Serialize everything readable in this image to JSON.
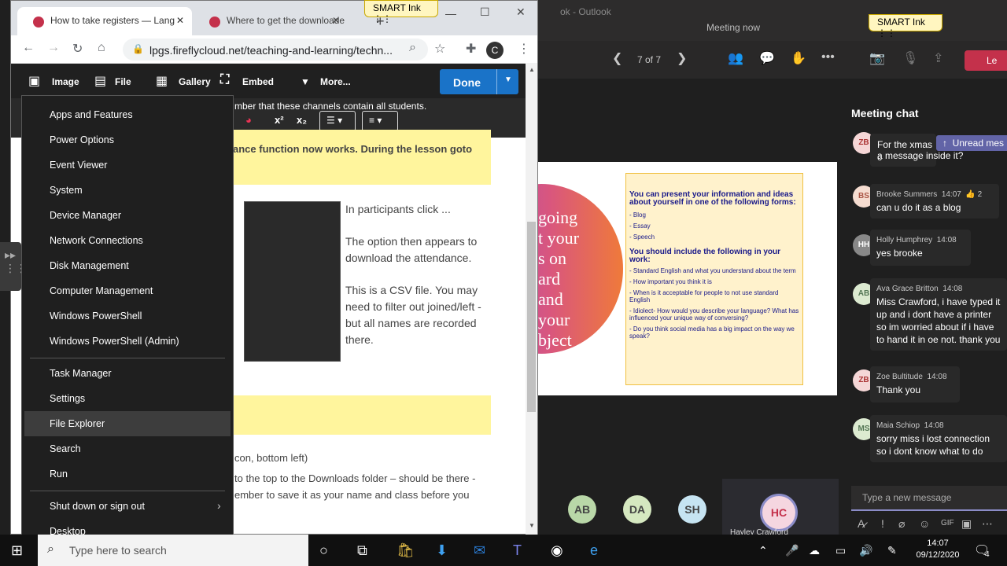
{
  "teams": {
    "window_title_left": "ok - Outlook",
    "window_title_right": "Meeting now",
    "page_counter": "7 of 7",
    "leave_label": "Le",
    "chat_title": "Meeting chat",
    "unread_label": "Unread mes",
    "compose_placeholder": "Type a new message",
    "slide": {
      "words": [
        "going",
        "t your",
        "s on",
        "ard",
        "and",
        "your",
        "bject"
      ],
      "heading": "You can present your information and ideas about yourself in one of the following forms:",
      "forms": [
        "- Blog",
        "- Essay",
        "- Speech"
      ],
      "heading2": "You should include the following in your work:",
      "points": [
        "- Standard English and what you understand about the term",
        "- How important you think it is",
        "- When is it acceptable for people to not use standard English",
        "- Idiolect- How would you describe your language? What has influenced your unique way of conversing?",
        "- Do you think social media has a big impact on the way we speak?"
      ]
    },
    "participants": [
      "AB",
      "DA",
      "SH"
    ],
    "presenter": {
      "initials": "HC",
      "name": "Hayley Crawford"
    },
    "messages": [
      {
        "initials": "ZB",
        "name": "",
        "time": "",
        "text": "For the xmas c... a message inside it?",
        "line1": "For the xmas c",
        "line2": "a message inside it?"
      },
      {
        "initials": "BS",
        "name": "Brooke Summers",
        "time": "14:07",
        "reaction": "2",
        "text": "can u do it as a blog"
      },
      {
        "initials": "HH",
        "name": "Holly Humphrey",
        "time": "14:08",
        "text": "yes brooke"
      },
      {
        "initials": "AB",
        "name": "Ava Grace Britton",
        "time": "14:08",
        "text": "Miss Crawford, i have typed it up and i dont have a printer so im worried about if i have to hand it in oe not. thank you"
      },
      {
        "initials": "ZB",
        "name": "Zoe Bultitude",
        "time": "14:08",
        "text": "Thank you"
      },
      {
        "initials": "MS",
        "name": "Maia Schiop",
        "time": "14:08",
        "text": "sorry miss i lost connection so i dont know what to do"
      }
    ]
  },
  "chrome": {
    "tabs": [
      {
        "label": "How to take registers — Lang"
      },
      {
        "label": "Where to get the downloade"
      }
    ],
    "url": "lpgs.fireflycloud.net/teaching-and-learning/techn...",
    "profile_initial": "C",
    "smart_ink": "SMART Ink"
  },
  "firefly": {
    "toolbar": [
      "Image",
      "File",
      "Gallery",
      "Embed",
      "More..."
    ],
    "done_label": "Done",
    "format_buttons": [
      "x²",
      "x₂"
    ],
    "page": {
      "line_top": "mber that these channels contain all students.",
      "yellow1": "ance function now works. During the lesson goto",
      "p1": "In participants click ...",
      "p2": "The option then appears to download the attendance.",
      "p3": "This is a CSV file. You may need to filter out joined/left - but all names are recorded there.",
      "l1": "con, bottom left)",
      "l2": "to the top to the Downloads folder – should be there -",
      "l3": "ember to save it as your name and class before you"
    }
  },
  "winx_menu": {
    "group1": [
      "Apps and Features",
      "Power Options",
      "Event Viewer",
      "System",
      "Device Manager",
      "Network Connections",
      "Disk Management",
      "Computer Management",
      "Windows PowerShell",
      "Windows PowerShell (Admin)"
    ],
    "group2": [
      "Task Manager",
      "Settings",
      "File Explorer",
      "Search",
      "Run"
    ],
    "group3": [
      "Shut down or sign out",
      "Desktop"
    ],
    "highlighted": "File Explorer"
  },
  "taskbar": {
    "search_placeholder": "Type here to search",
    "time": "14:07",
    "date": "09/12/2020",
    "notification_count": "4"
  }
}
